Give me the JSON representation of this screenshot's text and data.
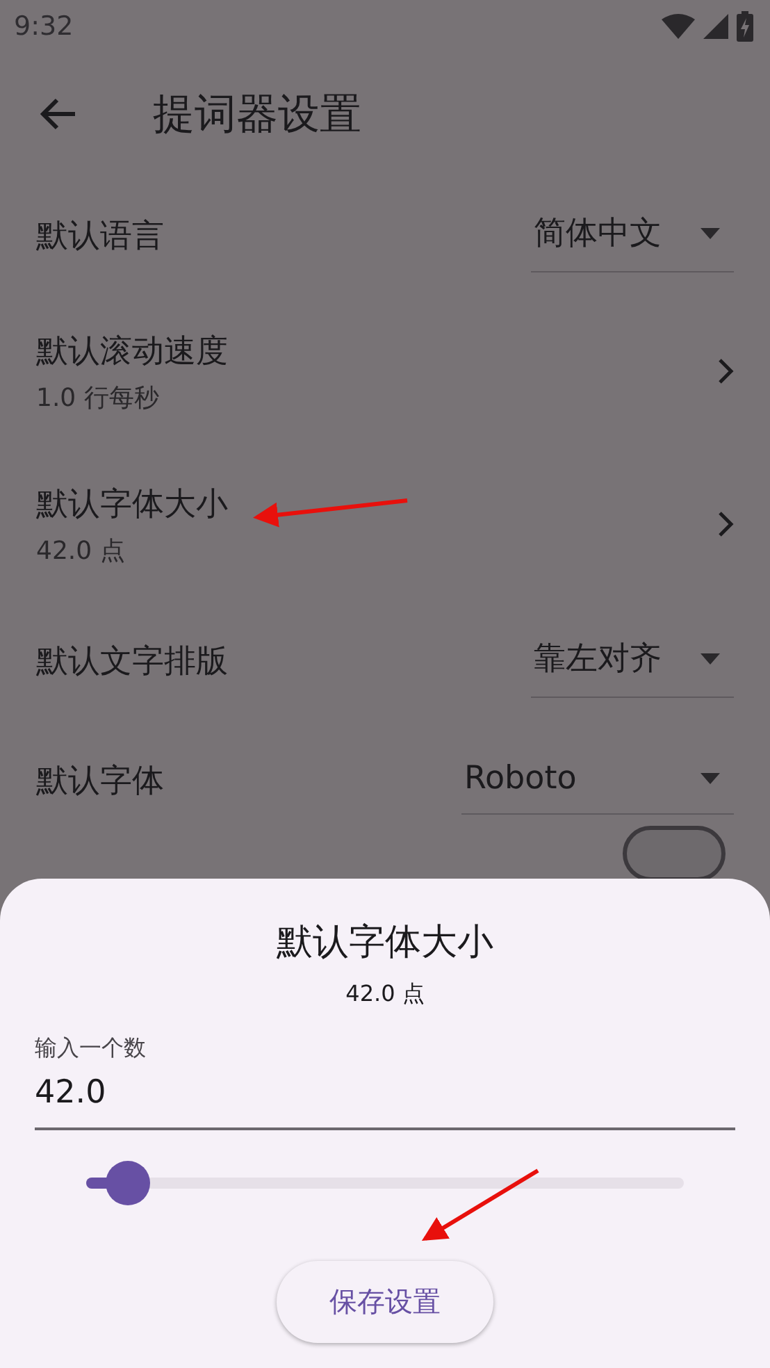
{
  "status_bar": {
    "time": "9:32"
  },
  "app_bar": {
    "title": "提词器设置"
  },
  "settings": [
    {
      "kind": "dropdown",
      "label": "默认语言",
      "value": "简体中文"
    },
    {
      "kind": "link",
      "label": "默认滚动速度",
      "subtitle": "1.0 行每秒"
    },
    {
      "kind": "link",
      "label": "默认字体大小",
      "subtitle": "42.0 点"
    },
    {
      "kind": "dropdown",
      "label": "默认文字排版",
      "value": "靠左对齐"
    },
    {
      "kind": "dropdown",
      "label": "默认字体",
      "value": "Roboto"
    },
    {
      "kind": "switch",
      "on": false
    }
  ],
  "sheet": {
    "title": "默认字体大小",
    "subtitle": "42.0 点",
    "field": {
      "label": "输入一个数",
      "value": "42.0"
    },
    "slider": {
      "level": 0.07
    },
    "button": "保存设置"
  }
}
